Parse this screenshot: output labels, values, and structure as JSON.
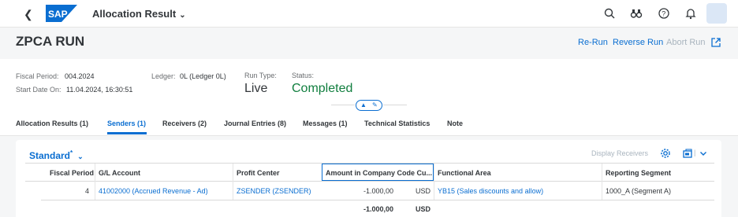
{
  "shell": {
    "app_title": "Allocation Result",
    "logo_text": "SAP",
    "icons": [
      "back-icon",
      "search-icon",
      "binoculars-icon",
      "help-icon",
      "bell-icon",
      "user-avatar"
    ]
  },
  "header": {
    "title": "ZPCA RUN",
    "actions": {
      "rerun": "Re-Run",
      "reverse_run": "Reverse Run",
      "abort_run": "Abort Run"
    },
    "attributes": {
      "fiscal_period_label": "Fiscal Period:",
      "fiscal_period_value": "004.2024",
      "start_date_label": "Start Date On:",
      "start_date_value": "11.04.2024, 16:30:51",
      "ledger_label": "Ledger:",
      "ledger_value": "0L (Ledger 0L)",
      "run_type_label": "Run Type:",
      "run_type_value": "Live",
      "status_label": "Status:",
      "status_value": "Completed"
    }
  },
  "tabs": [
    {
      "label": "Allocation Results (1)"
    },
    {
      "label": "Senders (1)"
    },
    {
      "label": "Receivers (2)"
    },
    {
      "label": "Journal Entries (8)"
    },
    {
      "label": "Messages (1)"
    },
    {
      "label": "Technical Statistics"
    },
    {
      "label": "Note"
    }
  ],
  "selected_tab": "Senders (1)",
  "table": {
    "variant": "Standard",
    "variant_marker": "*",
    "toolbar": {
      "display_receivers": "Display Receivers"
    },
    "columns": [
      "Fiscal Period",
      "G/L Account",
      "Profit Center",
      "Amount in Company Code Cu...",
      "Functional Area",
      "Reporting Segment"
    ],
    "rows": [
      {
        "fiscal_period": "4",
        "gl_account": "41002000 (Accrued Revenue - Ad)",
        "profit_center": "ZSENDER (ZSENDER)",
        "amount": "-1.000,00",
        "currency": "USD",
        "functional_area": "YB15 (Sales discounts and allow)",
        "reporting_segment": "1000_A (Segment A)"
      }
    ],
    "total": {
      "amount": "-1.000,00",
      "currency": "USD"
    }
  },
  "colors": {
    "accent": "#0a6ed1",
    "status_positive": "#107e3e",
    "disabled": "#a9b4be"
  }
}
